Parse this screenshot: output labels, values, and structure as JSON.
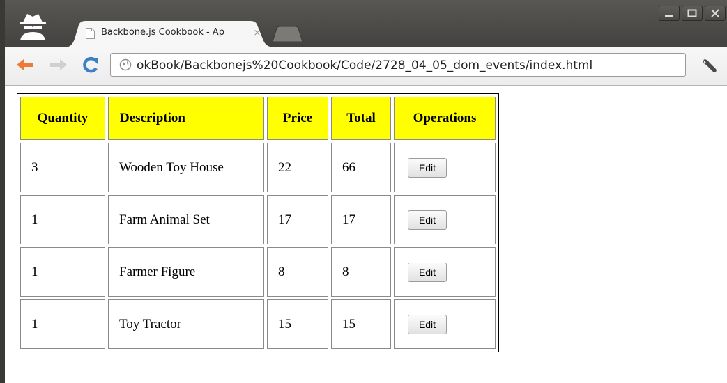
{
  "browser": {
    "tab_title": "Backbone.js Cookbook - Ap",
    "tab_close": "×",
    "url": "okBook/Backbonejs%20Cookbook/Code/2728_04_05_dom_events/index.html",
    "icons": [
      "incognito-icon",
      "page-icon",
      "back-arrow-icon",
      "forward-arrow-icon",
      "reload-icon",
      "globe-icon",
      "wrench-icon",
      "minimize-icon",
      "maximize-icon",
      "close-icon"
    ]
  },
  "table": {
    "headers": [
      "Quantity",
      "Description",
      "Price",
      "Total",
      "Operations"
    ],
    "header_color": "#ffff00",
    "rows": [
      {
        "quantity": "3",
        "description": "Wooden Toy House",
        "price": "22",
        "total": "66",
        "action": "Edit"
      },
      {
        "quantity": "1",
        "description": "Farm Animal Set",
        "price": "17",
        "total": "17",
        "action": "Edit"
      },
      {
        "quantity": "1",
        "description": "Farmer Figure",
        "price": "8",
        "total": "8",
        "action": "Edit"
      },
      {
        "quantity": "1",
        "description": "Toy Tractor",
        "price": "15",
        "total": "15",
        "action": "Edit"
      }
    ]
  }
}
